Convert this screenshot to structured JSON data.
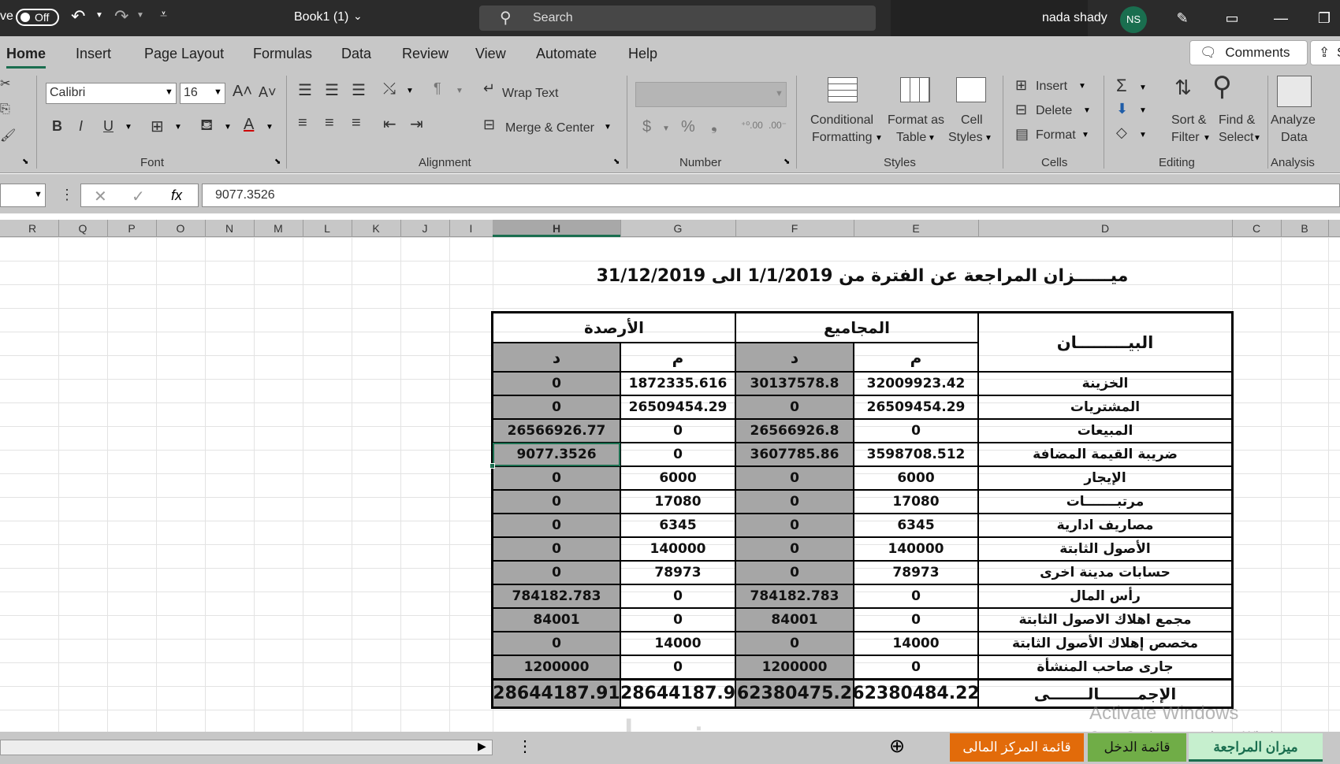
{
  "titlebar": {
    "autosave_label": "ve",
    "autosave_state": "Off",
    "doc_title": "Book1 (1)",
    "search_placeholder": "Search",
    "user_name": "nada shady",
    "user_initials": "NS"
  },
  "tabs": [
    "Home",
    "Insert",
    "Page Layout",
    "Formulas",
    "Data",
    "Review",
    "View",
    "Automate",
    "Help"
  ],
  "comments_label": "Comments",
  "share_label": "S",
  "ribbon": {
    "font_name": "Calibri",
    "font_size": "16",
    "wrap_text": "Wrap Text",
    "merge_center": "Merge & Center",
    "cond_format_1": "Conditional",
    "cond_format_2": "Formatting",
    "format_table_1": "Format as",
    "format_table_2": "Table",
    "cell_styles_1": "Cell",
    "cell_styles_2": "Styles",
    "insert": "Insert",
    "delete": "Delete",
    "format": "Format",
    "sort_1": "Sort &",
    "sort_2": "Filter",
    "find_1": "Find &",
    "find_2": "Select",
    "analyze_1": "Analyze",
    "analyze_2": "Data",
    "groups": {
      "font": "Font",
      "alignment": "Alignment",
      "number": "Number",
      "styles": "Styles",
      "cells": "Cells",
      "editing": "Editing",
      "analysis": "Analysis"
    }
  },
  "formula_value": "9077.3526",
  "columns": [
    "R",
    "Q",
    "P",
    "O",
    "N",
    "M",
    "L",
    "K",
    "J",
    "I",
    "H",
    "G",
    "F",
    "E",
    "D",
    "C",
    "B"
  ],
  "sheet": {
    "title": "ميــــــزان المراجعة عن الفترة من 1/1/2019 الى 31/12/2019",
    "header_label": "البيـــــــــان",
    "header_totals": "المجاميع",
    "header_balances": "الأرصدة",
    "sub_m": "م",
    "sub_d": "د",
    "rows": [
      {
        "label": "الخزينة",
        "e": "32009923.42",
        "f": "30137578.8",
        "g": "1872335.616",
        "h": "0"
      },
      {
        "label": "المشتريات",
        "e": "26509454.29",
        "f": "0",
        "g": "26509454.29",
        "h": "0"
      },
      {
        "label": "المبيعات",
        "e": "0",
        "f": "26566926.8",
        "g": "0",
        "h": "26566926.77"
      },
      {
        "label": "ضريبة القيمة المضافة",
        "e": "3598708.512",
        "f": "3607785.86",
        "g": "0",
        "h": "9077.3526"
      },
      {
        "label": "الإيجار",
        "e": "6000",
        "f": "0",
        "g": "6000",
        "h": "0"
      },
      {
        "label": "مرتبـــــــات",
        "e": "17080",
        "f": "0",
        "g": "17080",
        "h": "0"
      },
      {
        "label": "مصاريف ادارية",
        "e": "6345",
        "f": "0",
        "g": "6345",
        "h": "0"
      },
      {
        "label": "الأصول الثابتة",
        "e": "140000",
        "f": "0",
        "g": "140000",
        "h": "0"
      },
      {
        "label": "حسابات مدينة اخرى",
        "e": "78973",
        "f": "0",
        "g": "78973",
        "h": "0"
      },
      {
        "label": "رأس المال",
        "e": "0",
        "f": "784182.783",
        "g": "0",
        "h": "784182.783"
      },
      {
        "label": "مجمع اهلاك الاصول الثابتة",
        "e": "0",
        "f": "84001",
        "g": "0",
        "h": "84001"
      },
      {
        "label": "مخصص إهلاك الأصول الثابتة",
        "e": "14000",
        "f": "0",
        "g": "14000",
        "h": "0"
      },
      {
        "label": "جارى صاحب المنشأة",
        "e": "0",
        "f": "1200000",
        "g": "0",
        "h": "1200000"
      }
    ],
    "total": {
      "label": "الإجمـــــــالـــــــى",
      "e": "62380484.22",
      "f": "62380475.2",
      "g": "28644187.9",
      "h": "28644187.91"
    }
  },
  "watermark": {
    "line1": "Activate Windows",
    "line2": "Go to Settings to activate Windows.",
    "logo": "خمسات"
  },
  "sheet_tabs": [
    {
      "label": "قائمة المركز المالى",
      "color": "#e26b0a"
    },
    {
      "label": "قائمة الدخل",
      "color": "#70ad47"
    },
    {
      "label": "ميزان المراجعة",
      "color": "#c6efce"
    }
  ]
}
